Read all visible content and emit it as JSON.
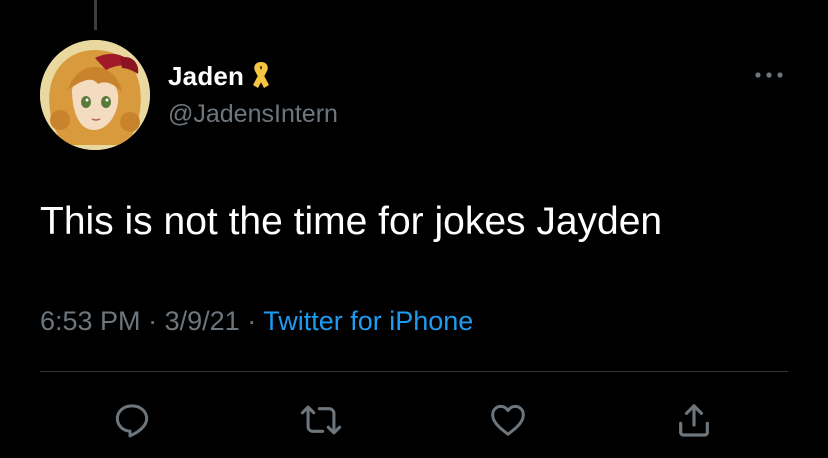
{
  "tweet": {
    "display_name": "Jaden",
    "handle": "@JadensIntern",
    "text": "This is not the time for jokes Jayden",
    "time": "6:53 PM",
    "date": "3/9/21",
    "separator": "·",
    "source": "Twitter for iPhone",
    "badge_icon": "awareness-ribbon-icon"
  },
  "actions": [
    {
      "name": "reply",
      "icon": "reply-icon"
    },
    {
      "name": "retweet",
      "icon": "retweet-icon"
    },
    {
      "name": "like",
      "icon": "heart-icon"
    },
    {
      "name": "share",
      "icon": "share-icon"
    }
  ],
  "colors": {
    "background": "#000000",
    "primary_text": "#ffffff",
    "secondary_text": "#6e767d",
    "link": "#1d9bf0",
    "divider": "#2f3336",
    "ribbon": "#f5c542"
  }
}
